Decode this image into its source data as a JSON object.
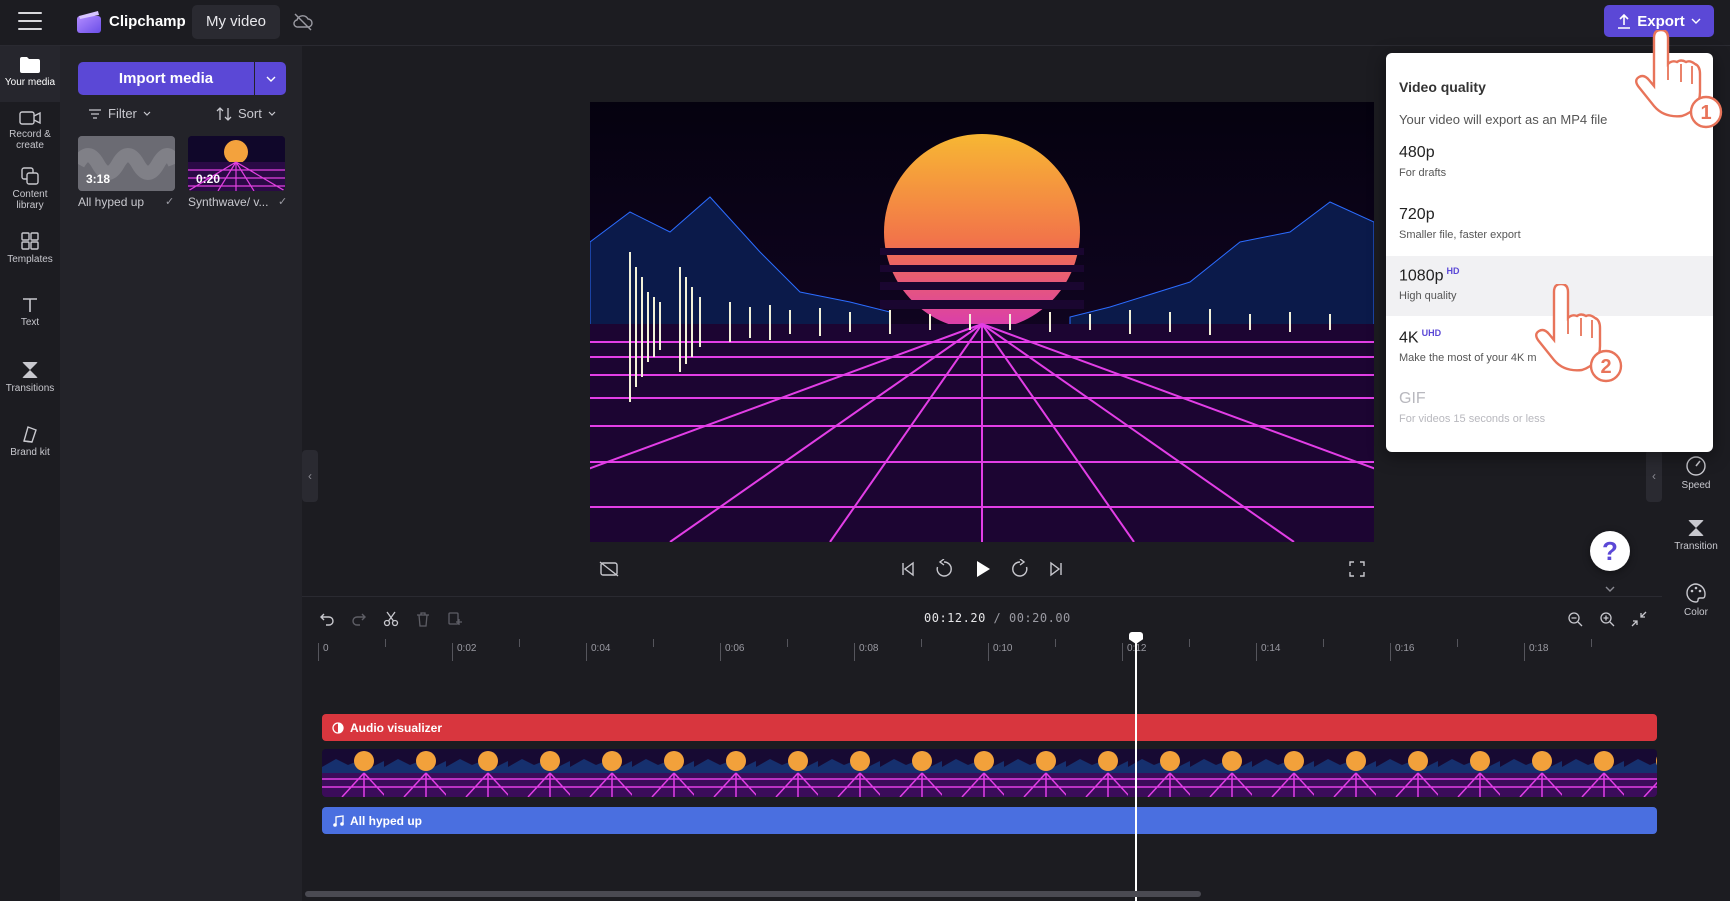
{
  "app": {
    "brand": "Clipchamp",
    "project_title": "My video"
  },
  "toolbar": {
    "export_label": "Export"
  },
  "rail": [
    {
      "label": "Your media"
    },
    {
      "label1": "Record &",
      "label2": "create"
    },
    {
      "label1": "Content",
      "label2": "library"
    },
    {
      "label": "Templates"
    },
    {
      "label": "Text"
    },
    {
      "label": "Transitions"
    },
    {
      "label": "Brand kit"
    }
  ],
  "media": {
    "import_label": "Import media",
    "filter_label": "Filter",
    "sort_label": "Sort",
    "items": [
      {
        "duration": "3:18",
        "name": "All hyped up"
      },
      {
        "duration": "0:20",
        "name": "Synthwave/ v..."
      }
    ]
  },
  "export_menu": {
    "title": "Video quality",
    "subtitle": "Your video will export as an MP4 file",
    "options": [
      {
        "label": "480p",
        "badge": "",
        "desc": "For drafts"
      },
      {
        "label": "720p",
        "badge": "",
        "desc": "Smaller file, faster export"
      },
      {
        "label": "1080p",
        "badge": "HD",
        "desc": "High quality"
      },
      {
        "label": "4K",
        "badge": "UHD",
        "desc": "Make the most of your 4K m"
      },
      {
        "label": "GIF",
        "badge": "",
        "desc": "For videos 15 seconds or less"
      }
    ]
  },
  "right_rail": [
    {
      "label": "Speed"
    },
    {
      "label": "Transition"
    },
    {
      "label": "Color"
    }
  ],
  "help_label": "?",
  "timeline": {
    "current": "00:12.20",
    "total": "/ 00:20.00",
    "ticks": [
      "0",
      "0:02",
      "0:04",
      "0:06",
      "0:08",
      "0:10",
      "0:12",
      "0:14",
      "0:16",
      "0:18"
    ],
    "tracks": {
      "audio_visualizer": "Audio visualizer",
      "music": "All hyped up"
    }
  },
  "annotations": {
    "step1": "1",
    "step2": "2"
  },
  "colors": {
    "accent": "#5b48d6",
    "visualizer_track": "#d8363e",
    "music_track": "#4a6fe0"
  }
}
